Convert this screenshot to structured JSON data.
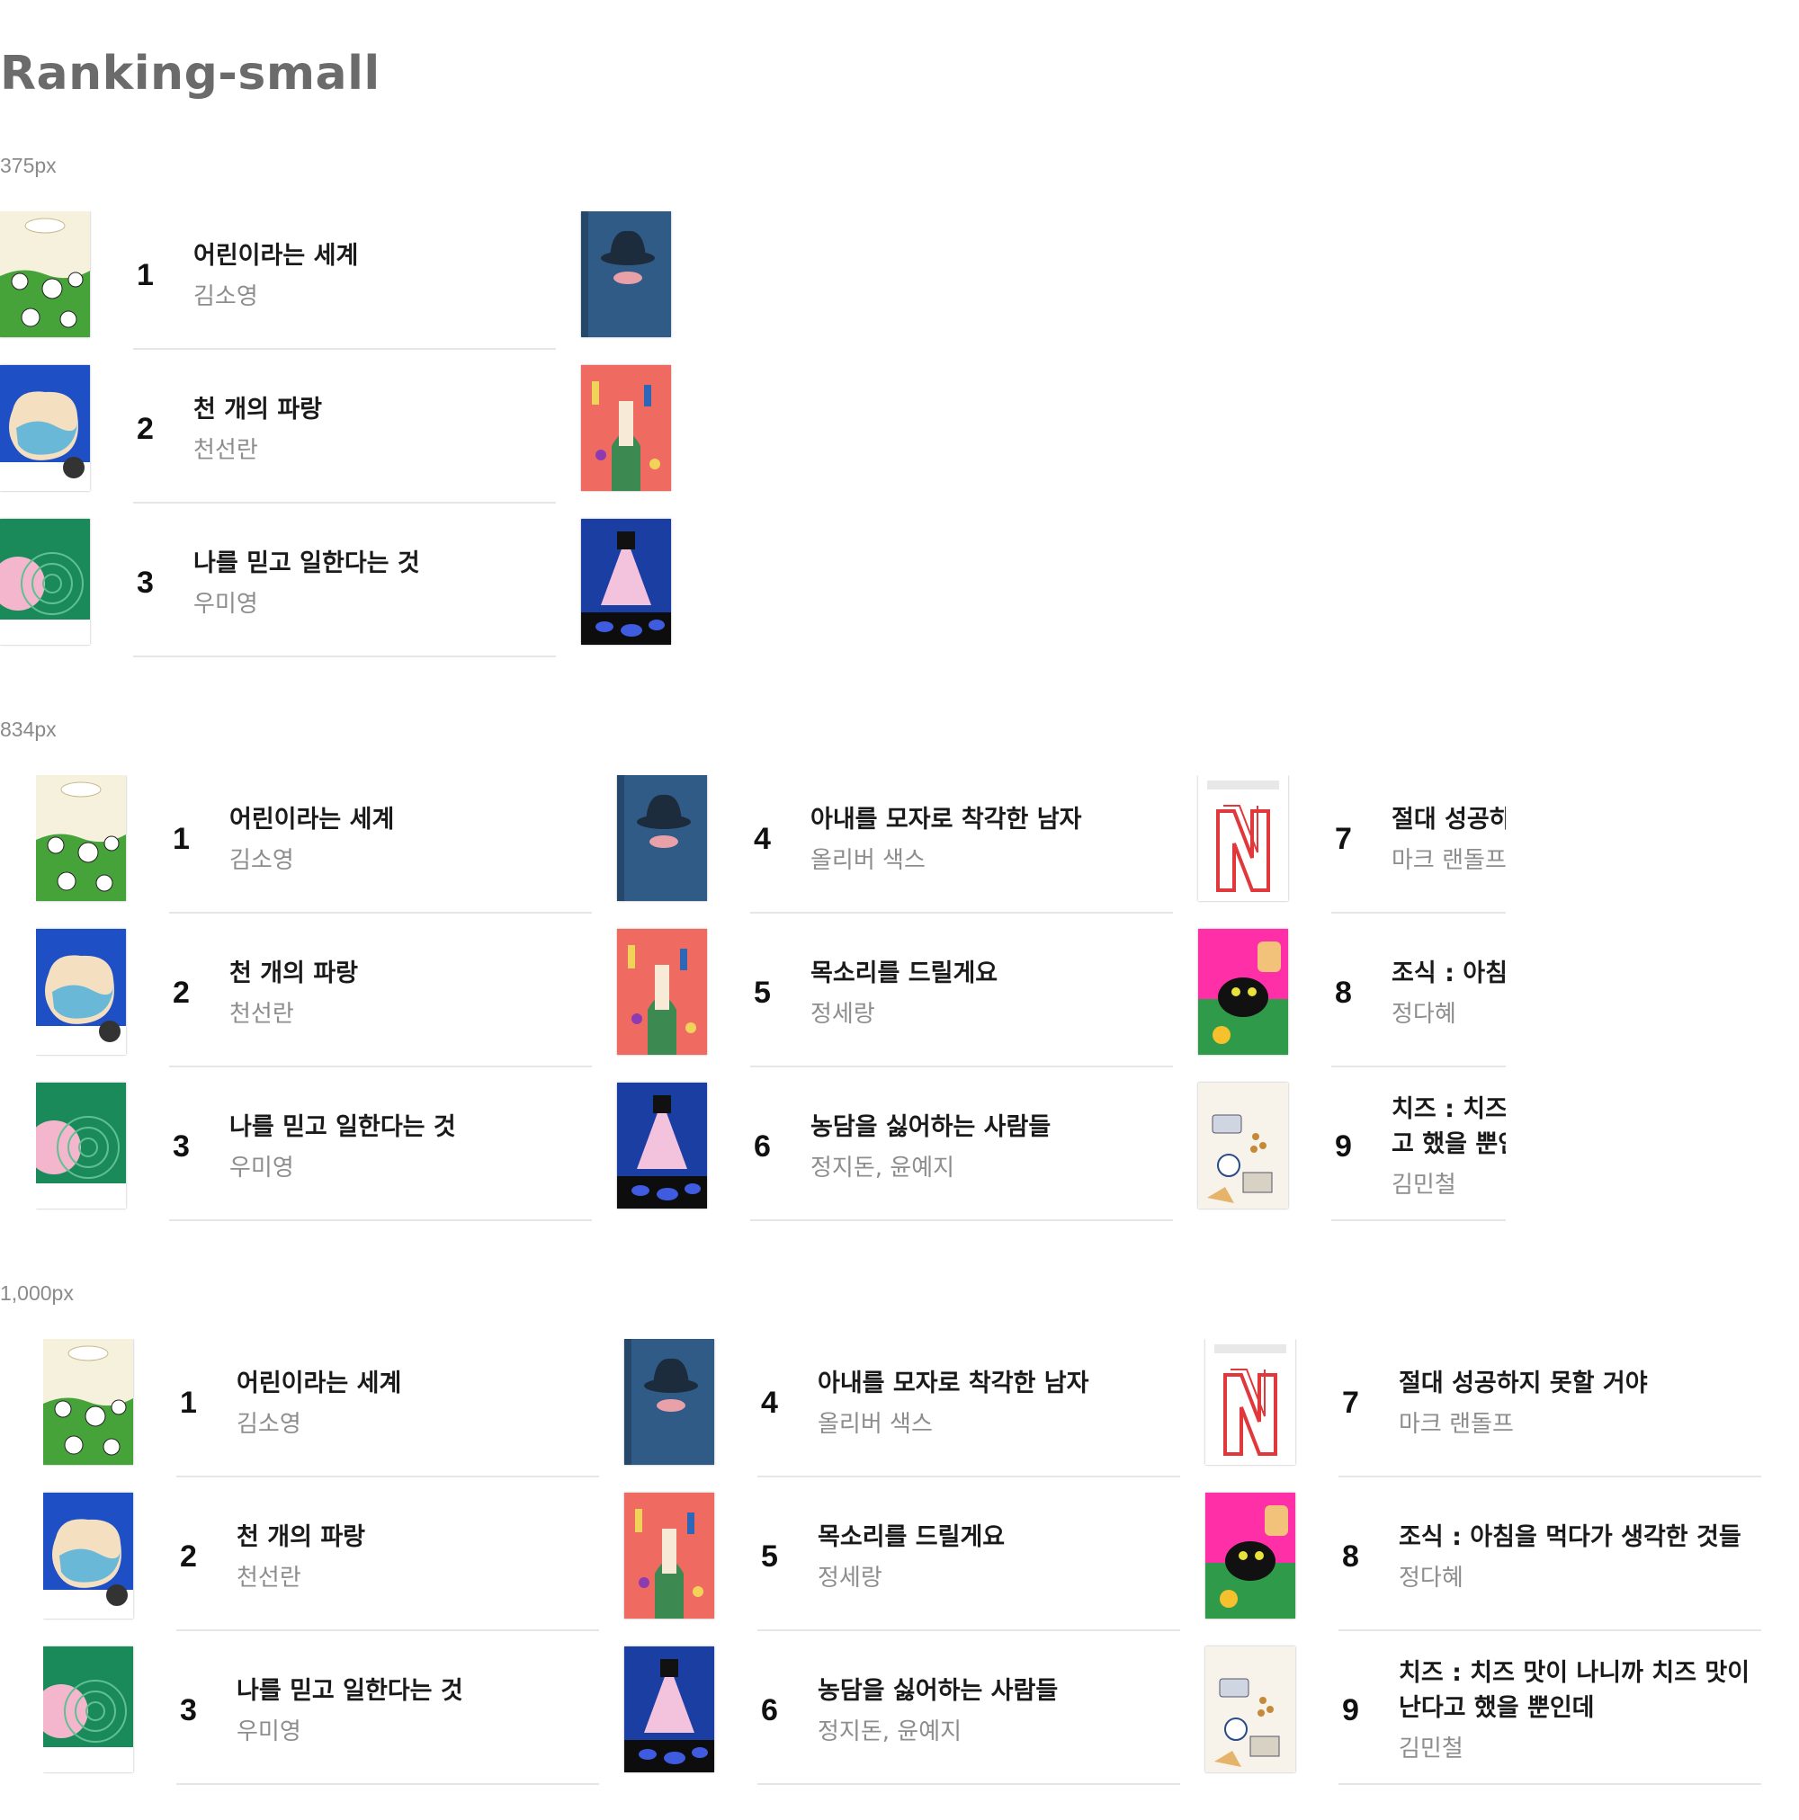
{
  "page_title": "Ranking-small",
  "sections": [
    {
      "label": "375px"
    },
    {
      "label": "834px"
    },
    {
      "label": "1,000px"
    }
  ],
  "books": [
    {
      "rank": "1",
      "title": "어린이라는 세계",
      "author": "김소영",
      "cover": "cover-1"
    },
    {
      "rank": "2",
      "title": "천 개의 파랑",
      "author": "천선란",
      "cover": "cover-2"
    },
    {
      "rank": "3",
      "title": "나를 믿고 일한다는 것",
      "author": "우미영",
      "cover": "cover-3"
    },
    {
      "rank": "4",
      "title": "아내를 모자로 착각한 남자",
      "author": "올리버 색스",
      "cover": "cover-4"
    },
    {
      "rank": "5",
      "title": "목소리를 드릴게요",
      "author": "정세랑",
      "cover": "cover-5"
    },
    {
      "rank": "6",
      "title": "농담을 싫어하는 사람들",
      "author": "정지돈, 윤예지",
      "cover": "cover-6"
    },
    {
      "rank": "7",
      "title": "절대 성공하지 못할 거야",
      "author": "마크 랜돌프",
      "cover": "cover-7"
    },
    {
      "rank": "8",
      "title": "조식 : 아침을 먹다가 생각한 것들",
      "author": "정다혜",
      "cover": "cover-8"
    },
    {
      "rank": "9",
      "title": "치즈 : 치즈 맛이 나니까 치즈 맛이 난다고 했을 뿐인데",
      "author": "김민철",
      "cover": "cover-9"
    }
  ]
}
